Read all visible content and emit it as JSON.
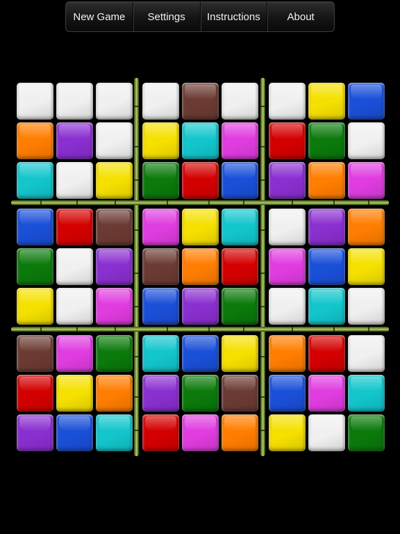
{
  "menu": {
    "items": [
      {
        "label": "New Game",
        "name": "new-game-button"
      },
      {
        "label": "Settings",
        "name": "settings-button"
      },
      {
        "label": "Instructions",
        "name": "instructions-button"
      },
      {
        "label": "About",
        "name": "about-button"
      }
    ]
  },
  "palette": {
    "W": "#f0f0f0",
    "N": "#6b3b33",
    "Y": "#f5e000",
    "B": "#1a4fd8",
    "O": "#ff7d00",
    "P": "#8a2fd0",
    "C": "#12c6cc",
    "M": "#e03ce0",
    "R": "#d40000",
    "G": "#0b7a0b"
  },
  "color_names": {
    "W": "white",
    "N": "brown",
    "Y": "yellow",
    "B": "blue",
    "O": "orange",
    "P": "purple",
    "C": "cyan",
    "M": "magenta",
    "R": "red",
    "G": "green"
  },
  "grid": [
    [
      "W",
      "W",
      "W",
      "W",
      "N",
      "W",
      "W",
      "Y",
      "B"
    ],
    [
      "O",
      "P",
      "W",
      "Y",
      "C",
      "M",
      "R",
      "G",
      "W"
    ],
    [
      "C",
      "W",
      "Y",
      "G",
      "R",
      "B",
      "P",
      "O",
      "M"
    ],
    [
      "B",
      "R",
      "N",
      "M",
      "Y",
      "C",
      "W",
      "P",
      "O"
    ],
    [
      "G",
      "W",
      "P",
      "N",
      "O",
      "R",
      "M",
      "B",
      "Y"
    ],
    [
      "Y",
      "W",
      "M",
      "B",
      "P",
      "G",
      "W",
      "C",
      "W"
    ],
    [
      "N",
      "M",
      "G",
      "C",
      "B",
      "Y",
      "O",
      "R",
      "W"
    ],
    [
      "R",
      "Y",
      "O",
      "P",
      "G",
      "N",
      "B",
      "M",
      "C"
    ],
    [
      "P",
      "B",
      "C",
      "R",
      "M",
      "O",
      "Y",
      "W",
      "G"
    ]
  ]
}
